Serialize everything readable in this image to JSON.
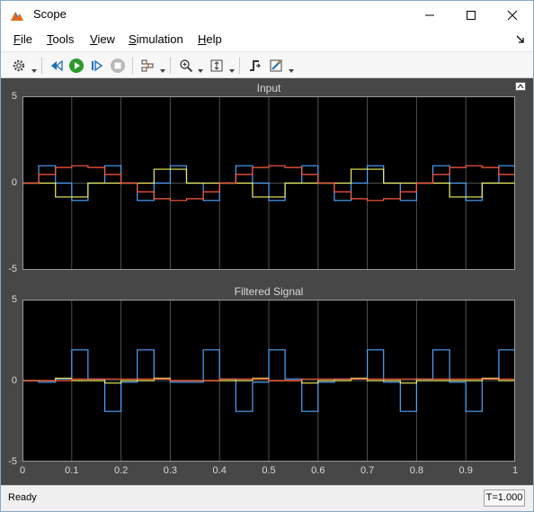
{
  "window": {
    "title": "Scope"
  },
  "menu": [
    "File",
    "Tools",
    "View",
    "Simulation",
    "Help"
  ],
  "toolbar_icons": [
    "configuration-gear-icon",
    "step-back-icon",
    "run-icon",
    "step-forward-icon",
    "stop-icon",
    "highlight-in-model-icon",
    "zoom-in-icon",
    "autoscale-icon",
    "triggers-icon",
    "signal-style-icon"
  ],
  "colors": {
    "figure_background": "#474747",
    "axes_background": "#000000",
    "grid": "#505050",
    "text": "#d8d8d8",
    "series_1": "#4da6ff",
    "series_2": "#f0f060",
    "series_3": "#ff5a3c"
  },
  "chart_data": [
    {
      "type": "line",
      "title": "Input",
      "xlim": [
        0,
        1
      ],
      "ylim": [
        -5,
        5
      ],
      "xticks": [],
      "yticks": [
        "5",
        "0",
        "-5"
      ],
      "grid": true,
      "step": true,
      "series": [
        {
          "color": "#4da6ff",
          "x": [
            0,
            0.033,
            0.067,
            0.1,
            0.133,
            0.167,
            0.2,
            0.233,
            0.267,
            0.3,
            0.333,
            0.367,
            0.4,
            0.433,
            0.467,
            0.5,
            0.533,
            0.567,
            0.6,
            0.633,
            0.667,
            0.7,
            0.733,
            0.767,
            0.8,
            0.833,
            0.867,
            0.9,
            0.933,
            0.967,
            1.0
          ],
          "y": [
            0,
            1,
            0,
            -1,
            0,
            1,
            0,
            -1,
            0,
            1,
            0,
            -1,
            0,
            1,
            0,
            -1,
            0,
            1,
            0,
            -1,
            0,
            1,
            0,
            -1,
            0,
            1,
            0,
            -1,
            0,
            1,
            1
          ]
        },
        {
          "color": "#f0f060",
          "x": [
            0,
            0.033,
            0.067,
            0.1,
            0.133,
            0.167,
            0.2,
            0.233,
            0.267,
            0.3,
            0.333,
            0.367,
            0.4,
            0.433,
            0.467,
            0.5,
            0.533,
            0.567,
            0.6,
            0.633,
            0.667,
            0.7,
            0.733,
            0.767,
            0.8,
            0.833,
            0.867,
            0.9,
            0.933,
            0.967,
            1.0
          ],
          "y": [
            0,
            0,
            -0.8,
            -0.8,
            0,
            0,
            0,
            0,
            0.8,
            0.8,
            0,
            0,
            0,
            0,
            -0.8,
            -0.8,
            0,
            0,
            0,
            0,
            0.8,
            0.8,
            0,
            0,
            0,
            0,
            -0.8,
            -0.8,
            0,
            0,
            0
          ]
        },
        {
          "color": "#ff5a3c",
          "x": [
            0,
            0.033,
            0.067,
            0.1,
            0.133,
            0.167,
            0.2,
            0.233,
            0.267,
            0.3,
            0.333,
            0.367,
            0.4,
            0.433,
            0.467,
            0.5,
            0.533,
            0.567,
            0.6,
            0.633,
            0.667,
            0.7,
            0.733,
            0.767,
            0.8,
            0.833,
            0.867,
            0.9,
            0.933,
            0.967,
            1.0
          ],
          "y": [
            0,
            0.5,
            0.9,
            1,
            0.9,
            0.5,
            0,
            -0.5,
            -0.9,
            -1,
            -0.9,
            -0.5,
            0,
            0.5,
            0.9,
            1,
            0.9,
            0.5,
            0,
            -0.5,
            -0.9,
            -1,
            -0.9,
            -0.5,
            0,
            0.5,
            0.9,
            1,
            0.9,
            0.5,
            0.5
          ]
        }
      ]
    },
    {
      "type": "line",
      "title": "Filtered Signal",
      "xlim": [
        0,
        1
      ],
      "ylim": [
        -5,
        5
      ],
      "xticks": [
        "0",
        "0.1",
        "0.2",
        "0.3",
        "0.4",
        "0.5",
        "0.6",
        "0.7",
        "0.8",
        "0.9",
        "1"
      ],
      "yticks": [
        "5",
        "0",
        "-5"
      ],
      "grid": true,
      "step": true,
      "series": [
        {
          "color": "#4da6ff",
          "x": [
            0,
            0.033,
            0.067,
            0.1,
            0.133,
            0.167,
            0.2,
            0.233,
            0.267,
            0.3,
            0.333,
            0.367,
            0.4,
            0.433,
            0.467,
            0.5,
            0.533,
            0.567,
            0.6,
            0.633,
            0.667,
            0.7,
            0.733,
            0.767,
            0.8,
            0.833,
            0.867,
            0.9,
            0.933,
            0.967,
            1.0
          ],
          "y": [
            0,
            -0.1,
            0.1,
            1.9,
            0.1,
            -1.9,
            -0.1,
            1.9,
            0.1,
            -0.1,
            -0.1,
            1.9,
            0.1,
            -1.9,
            -0.1,
            1.9,
            0.1,
            -1.9,
            -0.1,
            0.1,
            0.1,
            1.9,
            -0.1,
            -1.9,
            0.1,
            1.9,
            -0.1,
            -1.9,
            0.1,
            1.9,
            1.9
          ]
        },
        {
          "color": "#f0f060",
          "x": [
            0,
            0.033,
            0.067,
            0.1,
            0.133,
            0.167,
            0.2,
            0.233,
            0.267,
            0.3,
            0.333,
            0.367,
            0.4,
            0.433,
            0.467,
            0.5,
            0.533,
            0.567,
            0.6,
            0.633,
            0.667,
            0.7,
            0.733,
            0.767,
            0.8,
            0.833,
            0.867,
            0.9,
            0.933,
            0.967,
            1.0
          ],
          "y": [
            0,
            0,
            0.15,
            0,
            0,
            -0.15,
            0,
            0,
            0.15,
            0,
            0,
            0,
            0,
            0,
            0.15,
            0,
            0,
            -0.15,
            0,
            0,
            0.15,
            0,
            0,
            -0.15,
            0,
            0,
            0,
            0,
            0.15,
            0,
            0
          ]
        },
        {
          "color": "#ff5a3c",
          "x": [
            0,
            0.033,
            0.067,
            0.1,
            0.133,
            0.167,
            0.2,
            0.233,
            0.267,
            0.3,
            0.333,
            0.367,
            0.4,
            0.433,
            0.467,
            0.5,
            0.533,
            0.567,
            0.6,
            0.633,
            0.667,
            0.7,
            0.733,
            0.767,
            0.8,
            0.833,
            0.867,
            0.9,
            0.933,
            0.967,
            1.0
          ],
          "y": [
            0,
            0,
            0,
            0.1,
            0.1,
            0.1,
            0.1,
            0.1,
            0.1,
            0,
            0,
            0,
            0.1,
            0.1,
            0.1,
            0,
            0,
            0.1,
            0.1,
            0.1,
            0.1,
            0.1,
            0.1,
            0.1,
            0.1,
            0.1,
            0.1,
            0.1,
            0.1,
            0.1,
            0.1
          ]
        }
      ]
    }
  ],
  "status": {
    "text": "Ready",
    "time": "T=1.000"
  }
}
